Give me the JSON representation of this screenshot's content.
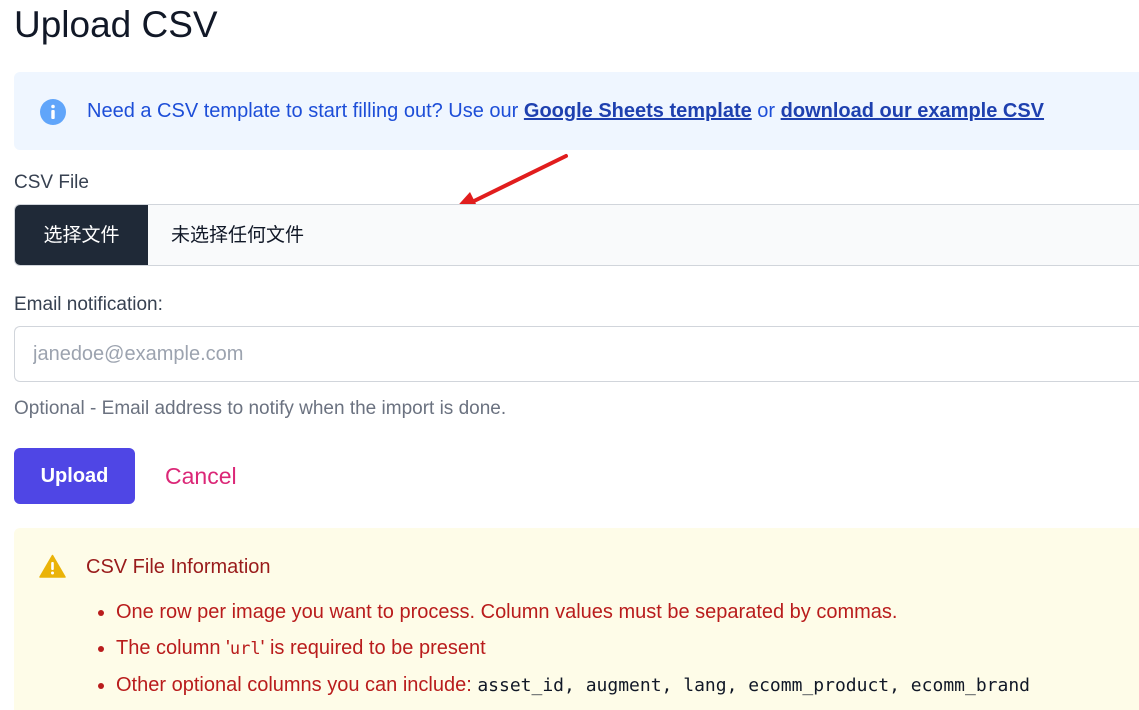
{
  "page": {
    "title": "Upload CSV"
  },
  "info_banner": {
    "icon": "info-icon",
    "text": "Need a CSV template to start filling out? Use our ",
    "link_google": "Google Sheets template",
    "or_text": " or ",
    "link_example": "download our example CSV"
  },
  "csv_field": {
    "label": "CSV File",
    "button_label": "选择文件",
    "status": "未选择任何文件"
  },
  "email_field": {
    "label": "Email notification:",
    "placeholder": "janedoe@example.com",
    "value": "",
    "help": "Optional - Email address to notify when the import is done."
  },
  "actions": {
    "upload_label": "Upload",
    "cancel_label": "Cancel"
  },
  "csv_info": {
    "icon": "warning-icon",
    "title": "CSV File Information",
    "items": [
      {
        "text": "One row per image you want to process. Column values must be separated by commas."
      },
      {
        "text_before": "The column '",
        "code": "url",
        "text_after": "' is required to be present"
      },
      {
        "text": "Other optional columns you can include: ",
        "code": "asset_id, augment, lang, ecomm_product, ecomm_brand"
      }
    ]
  },
  "colors": {
    "primary": "#4f46e5",
    "cancel": "#db2777",
    "info_bg": "#eff6ff",
    "warn_bg": "#fefce8",
    "warn_text": "#b91c1c",
    "annotation_arrow": "#e11d1d"
  }
}
